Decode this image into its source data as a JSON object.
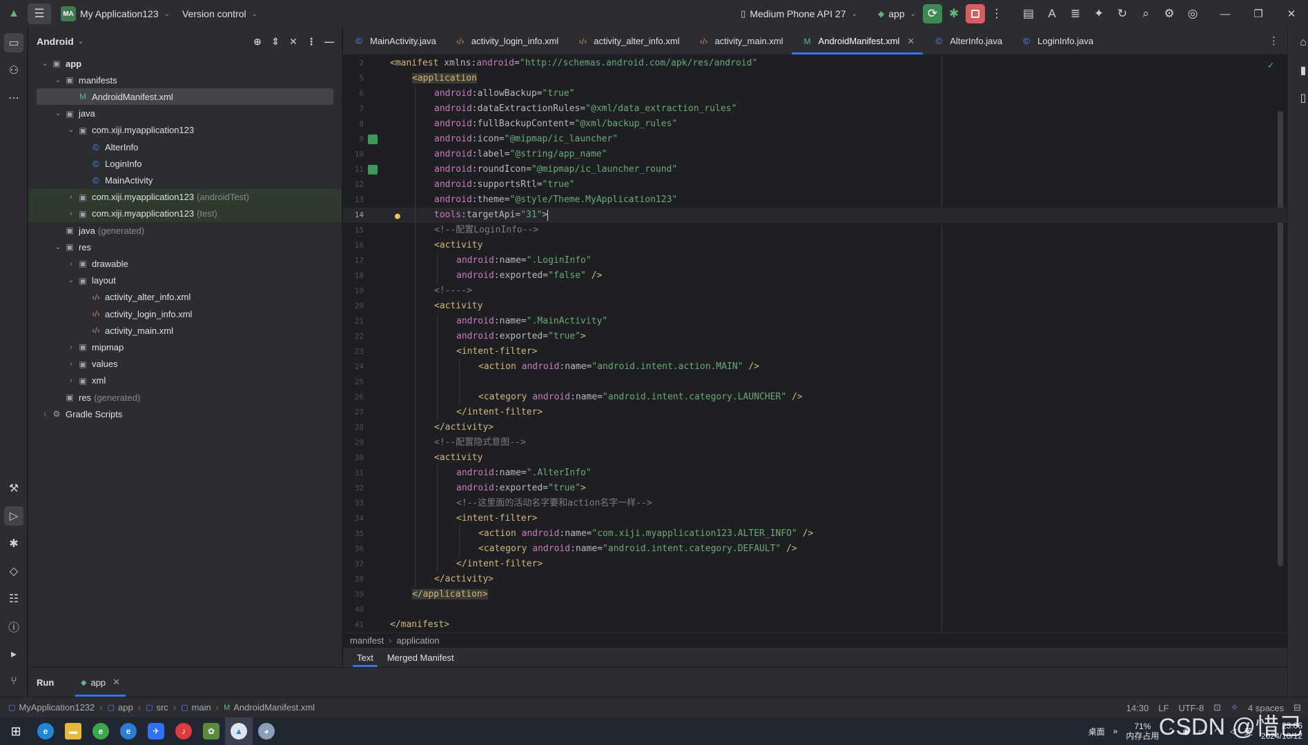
{
  "titlebar": {
    "project_badge": "MA",
    "project_name": "My Application123",
    "vcs": "Version control",
    "device": "Medium Phone API 27",
    "run_config": "app"
  },
  "project_panel": {
    "title": "Android",
    "tree": [
      {
        "label": "app",
        "depth": 0,
        "icon": "folder",
        "open": true,
        "bold": true
      },
      {
        "label": "manifests",
        "depth": 1,
        "icon": "folder",
        "open": true
      },
      {
        "label": "AndroidManifest.xml",
        "depth": 2,
        "icon": "mf",
        "selected": true
      },
      {
        "label": "java",
        "depth": 1,
        "icon": "folder",
        "open": true
      },
      {
        "label": "com.xiji.myapplication123",
        "depth": 2,
        "icon": "folder",
        "open": true
      },
      {
        "label": "AlterInfo",
        "depth": 3,
        "icon": "class"
      },
      {
        "label": "LoginInfo",
        "depth": 3,
        "icon": "class"
      },
      {
        "label": "MainActivity",
        "depth": 3,
        "icon": "class"
      },
      {
        "label": "com.xiji.myapplication123",
        "suffix": "(androidTest)",
        "depth": 2,
        "icon": "folder",
        "closed": true,
        "test": true
      },
      {
        "label": "com.xiji.myapplication123",
        "suffix": "(test)",
        "depth": 2,
        "icon": "folder",
        "closed": true,
        "test": true
      },
      {
        "label": "java",
        "suffix": "(generated)",
        "depth": 1,
        "icon": "folder"
      },
      {
        "label": "res",
        "depth": 1,
        "icon": "folder",
        "open": true
      },
      {
        "label": "drawable",
        "depth": 2,
        "icon": "folder",
        "closed": true
      },
      {
        "label": "layout",
        "depth": 2,
        "icon": "folder",
        "open": true
      },
      {
        "label": "activity_alter_info.xml",
        "depth": 3,
        "icon": "xml"
      },
      {
        "label": "activity_login_info.xml",
        "depth": 3,
        "icon": "xml"
      },
      {
        "label": "activity_main.xml",
        "depth": 3,
        "icon": "xml"
      },
      {
        "label": "mipmap",
        "depth": 2,
        "icon": "folder",
        "closed": true
      },
      {
        "label": "values",
        "depth": 2,
        "icon": "folder",
        "closed": true
      },
      {
        "label": "xml",
        "depth": 2,
        "icon": "folder",
        "closed": true
      },
      {
        "label": "res",
        "suffix": "(generated)",
        "depth": 1,
        "icon": "folder"
      },
      {
        "label": "Gradle Scripts",
        "depth": 0,
        "icon": "gradle",
        "closed": true
      }
    ]
  },
  "editor_tabs": [
    {
      "label": "MainActivity.java",
      "icon": "class"
    },
    {
      "label": "activity_login_info.xml",
      "icon": "xml"
    },
    {
      "label": "activity_alter_info.xml",
      "icon": "xml"
    },
    {
      "label": "activity_main.xml",
      "icon": "xml"
    },
    {
      "label": "AndroidManifest.xml",
      "icon": "mf",
      "active": true
    },
    {
      "label": "AlterInfo.java",
      "icon": "class"
    },
    {
      "label": "LoginInfo.java",
      "icon": "class"
    }
  ],
  "code_lines": [
    {
      "n": "2",
      "indent": 0,
      "segs": [
        [
          "t-tag",
          "<manifest "
        ],
        [
          "t-attr",
          "xmlns:"
        ],
        [
          "t-ns",
          "android"
        ],
        [
          "t-attr",
          "="
        ],
        [
          "t-val",
          "\"http://schemas.android.com/apk/res/android\""
        ]
      ]
    },
    {
      "n": "5",
      "indent": 1,
      "segs": [
        [
          "t-tag t-hl",
          "<application"
        ]
      ]
    },
    {
      "n": "6",
      "indent": 2,
      "segs": [
        [
          "t-ns",
          "android"
        ],
        [
          "t-attr",
          ":allowBackup="
        ],
        [
          "t-val",
          "\"true\""
        ]
      ]
    },
    {
      "n": "7",
      "indent": 2,
      "segs": [
        [
          "t-ns",
          "android"
        ],
        [
          "t-attr",
          ":dataExtractionRules="
        ],
        [
          "t-val",
          "\"@xml/data_extraction_rules\""
        ]
      ]
    },
    {
      "n": "8",
      "indent": 2,
      "segs": [
        [
          "t-ns",
          "android"
        ],
        [
          "t-attr",
          ":fullBackupContent="
        ],
        [
          "t-val",
          "\"@xml/backup_rules\""
        ]
      ]
    },
    {
      "n": "9",
      "indent": 2,
      "mark": true,
      "segs": [
        [
          "t-ns",
          "android"
        ],
        [
          "t-attr",
          ":icon="
        ],
        [
          "t-val",
          "\"@mipmap/ic_launcher\""
        ]
      ]
    },
    {
      "n": "10",
      "indent": 2,
      "segs": [
        [
          "t-ns",
          "android"
        ],
        [
          "t-attr",
          ":label="
        ],
        [
          "t-val",
          "\"@string/app_name\""
        ]
      ]
    },
    {
      "n": "11",
      "indent": 2,
      "mark": true,
      "segs": [
        [
          "t-ns",
          "android"
        ],
        [
          "t-attr",
          ":roundIcon="
        ],
        [
          "t-val",
          "\"@mipmap/ic_launcher_round\""
        ]
      ]
    },
    {
      "n": "12",
      "indent": 2,
      "segs": [
        [
          "t-ns",
          "android"
        ],
        [
          "t-attr",
          ":supportsRtl="
        ],
        [
          "t-val",
          "\"true\""
        ]
      ]
    },
    {
      "n": "13",
      "indent": 2,
      "segs": [
        [
          "t-ns",
          "android"
        ],
        [
          "t-attr",
          ":theme="
        ],
        [
          "t-val",
          "\"@style/Theme.MyApplication123\""
        ]
      ]
    },
    {
      "n": "14",
      "indent": 2,
      "current": true,
      "bulb": true,
      "caret": true,
      "segs": [
        [
          "t-ns",
          "tools"
        ],
        [
          "t-attr",
          ":targetApi="
        ],
        [
          "t-val",
          "\"31\""
        ],
        [
          "t-tag",
          ">"
        ]
      ]
    },
    {
      "n": "15",
      "indent": 2,
      "segs": [
        [
          "t-com",
          "<!--配置LoginInfo-->"
        ]
      ]
    },
    {
      "n": "16",
      "indent": 2,
      "segs": [
        [
          "t-tag",
          "<activity"
        ]
      ]
    },
    {
      "n": "17",
      "indent": 3,
      "segs": [
        [
          "t-ns",
          "android"
        ],
        [
          "t-attr",
          ":name="
        ],
        [
          "t-val",
          "\".LoginInfo\""
        ]
      ]
    },
    {
      "n": "18",
      "indent": 3,
      "segs": [
        [
          "t-ns",
          "android"
        ],
        [
          "t-attr",
          ":exported="
        ],
        [
          "t-val",
          "\"false\""
        ],
        [
          "t-tag",
          " />"
        ]
      ]
    },
    {
      "n": "19",
      "indent": 2,
      "segs": [
        [
          "t-com",
          "<!---->"
        ]
      ]
    },
    {
      "n": "20",
      "indent": 2,
      "segs": [
        [
          "t-tag",
          "<activity"
        ]
      ]
    },
    {
      "n": "21",
      "indent": 3,
      "segs": [
        [
          "t-ns",
          "android"
        ],
        [
          "t-attr",
          ":name="
        ],
        [
          "t-val",
          "\".MainActivity\""
        ]
      ]
    },
    {
      "n": "22",
      "indent": 3,
      "segs": [
        [
          "t-ns",
          "android"
        ],
        [
          "t-attr",
          ":exported="
        ],
        [
          "t-val",
          "\"true\""
        ],
        [
          "t-tag",
          ">"
        ]
      ]
    },
    {
      "n": "23",
      "indent": 3,
      "segs": [
        [
          "t-tag",
          "<intent-filter>"
        ]
      ]
    },
    {
      "n": "24",
      "indent": 4,
      "segs": [
        [
          "t-tag",
          "<action "
        ],
        [
          "t-ns",
          "android"
        ],
        [
          "t-attr",
          ":name="
        ],
        [
          "t-val",
          "\"android.intent.action.MAIN\""
        ],
        [
          "t-tag",
          " />"
        ]
      ]
    },
    {
      "n": "25",
      "indent": 4,
      "segs": []
    },
    {
      "n": "26",
      "indent": 4,
      "segs": [
        [
          "t-tag",
          "<category "
        ],
        [
          "t-ns",
          "android"
        ],
        [
          "t-attr",
          ":name="
        ],
        [
          "t-val",
          "\"android.intent.category.LAUNCHER\""
        ],
        [
          "t-tag",
          " />"
        ]
      ]
    },
    {
      "n": "27",
      "indent": 3,
      "segs": [
        [
          "t-tag",
          "</intent-filter>"
        ]
      ]
    },
    {
      "n": "28",
      "indent": 2,
      "segs": [
        [
          "t-tag",
          "</activity>"
        ]
      ]
    },
    {
      "n": "29",
      "indent": 2,
      "segs": [
        [
          "t-com",
          "<!--配置隐式意图-->"
        ]
      ]
    },
    {
      "n": "30",
      "indent": 2,
      "segs": [
        [
          "t-tag",
          "<activity"
        ]
      ]
    },
    {
      "n": "31",
      "indent": 3,
      "segs": [
        [
          "t-ns",
          "android"
        ],
        [
          "t-attr",
          ":name="
        ],
        [
          "t-val",
          "\".AlterInfo\""
        ]
      ]
    },
    {
      "n": "32",
      "indent": 3,
      "segs": [
        [
          "t-ns",
          "android"
        ],
        [
          "t-attr",
          ":exported="
        ],
        [
          "t-val",
          "\"true\""
        ],
        [
          "t-tag",
          ">"
        ]
      ]
    },
    {
      "n": "33",
      "indent": 3,
      "segs": [
        [
          "t-com",
          "<!--这里面的活动名字要和action名字一样-->"
        ]
      ]
    },
    {
      "n": "34",
      "indent": 3,
      "segs": [
        [
          "t-tag",
          "<intent-filter>"
        ]
      ]
    },
    {
      "n": "35",
      "indent": 4,
      "segs": [
        [
          "t-tag",
          "<action "
        ],
        [
          "t-ns",
          "android"
        ],
        [
          "t-attr",
          ":name="
        ],
        [
          "t-val",
          "\"com.xiji.myapplication123.ALTER_INFO\""
        ],
        [
          "t-tag",
          " />"
        ]
      ]
    },
    {
      "n": "36",
      "indent": 4,
      "segs": [
        [
          "t-tag",
          "<category "
        ],
        [
          "t-ns",
          "android"
        ],
        [
          "t-attr",
          ":name="
        ],
        [
          "t-val",
          "\"android.intent.category.DEFAULT\""
        ],
        [
          "t-tag",
          " />"
        ]
      ]
    },
    {
      "n": "37",
      "indent": 3,
      "segs": [
        [
          "t-tag",
          "</intent-filter>"
        ]
      ]
    },
    {
      "n": "38",
      "indent": 2,
      "segs": [
        [
          "t-tag",
          "</activity>"
        ]
      ]
    },
    {
      "n": "39",
      "indent": 1,
      "segs": [
        [
          "t-tag t-hl",
          "</application>"
        ]
      ]
    },
    {
      "n": "40",
      "indent": 0,
      "segs": []
    },
    {
      "n": "41",
      "indent": 0,
      "segs": [
        [
          "t-tag",
          "</manifest>"
        ]
      ]
    }
  ],
  "breadcrumb": [
    "manifest",
    "application"
  ],
  "bottom_tabs": [
    {
      "label": "Text",
      "active": true
    },
    {
      "label": "Merged Manifest"
    }
  ],
  "run": {
    "label": "Run",
    "tab": "app"
  },
  "statusbar": {
    "path": [
      "MyApplication1232",
      "app",
      "src",
      "main",
      "AndroidManifest.xml"
    ],
    "position": "14:30",
    "line_sep": "LF",
    "encoding": "UTF-8",
    "indent": "4 spaces"
  },
  "taskbar": {
    "desktop": "桌面",
    "mem_pct": "71%",
    "mem_label": "内存占用",
    "ime": "英",
    "time": "23:06",
    "date": "2024/10/12"
  },
  "watermark": "CSDN @惜己",
  "colors": {
    "accent": "#3574f0",
    "bg": "#1e1f22",
    "panel": "#2b2d30",
    "run_green": "#5fb878",
    "stop_red": "#db5c5c"
  }
}
